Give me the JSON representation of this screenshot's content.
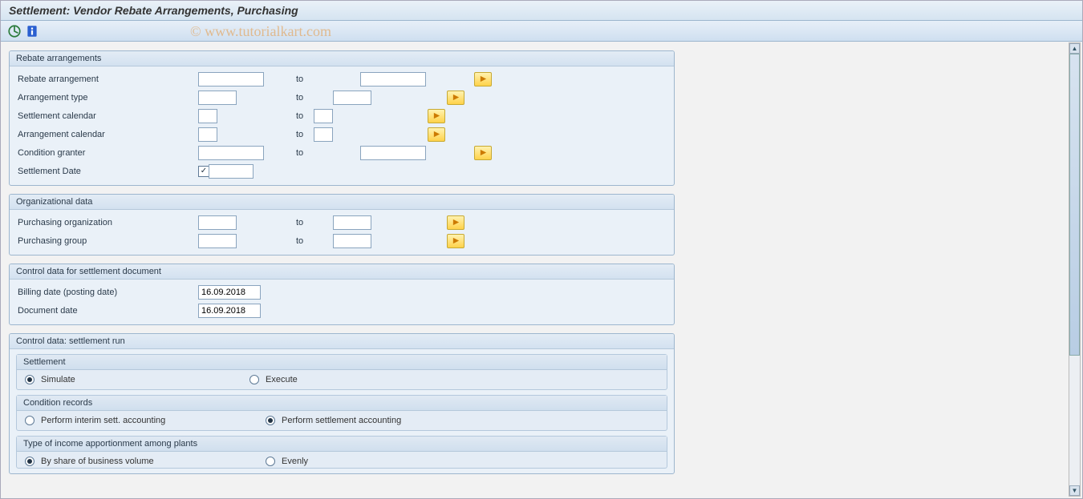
{
  "title": "Settlement: Vendor Rebate Arrangements, Purchasing",
  "watermark": "© www.tutorialkart.com",
  "groups": {
    "rebate": {
      "title": "Rebate arrangements",
      "rows": {
        "rebate_arrangement": {
          "label": "Rebate arrangement",
          "to": "to"
        },
        "arrangement_type": {
          "label": "Arrangement type",
          "to": "to"
        },
        "settlement_calendar": {
          "label": "Settlement calendar",
          "to": "to"
        },
        "arrangement_calendar": {
          "label": "Arrangement calendar",
          "to": "to"
        },
        "condition_granter": {
          "label": "Condition granter",
          "to": "to"
        },
        "settlement_date": {
          "label": "Settlement Date",
          "checked": true
        }
      }
    },
    "org": {
      "title": "Organizational data",
      "rows": {
        "purchasing_org": {
          "label": "Purchasing organization",
          "to": "to"
        },
        "purchasing_group": {
          "label": "Purchasing group",
          "to": "to"
        }
      }
    },
    "ctrl_doc": {
      "title": "Control data for settlement document",
      "rows": {
        "billing_date": {
          "label": "Billing date (posting date)",
          "value": "16.09.2018"
        },
        "document_date": {
          "label": "Document date",
          "value": "16.09.2018"
        }
      }
    },
    "ctrl_run": {
      "title": "Control data: settlement run",
      "settlement": {
        "title": "Settlement",
        "opt_simulate": "Simulate",
        "opt_execute": "Execute",
        "selected": "simulate"
      },
      "condition": {
        "title": "Condition records",
        "opt_interim": "Perform interim sett. accounting",
        "opt_settle": "Perform settlement accounting",
        "selected": "settle"
      },
      "apportion": {
        "title": "Type of income apportionment among plants",
        "opt_share": "By share of business volume",
        "opt_evenly": "Evenly",
        "selected": "share"
      }
    }
  }
}
